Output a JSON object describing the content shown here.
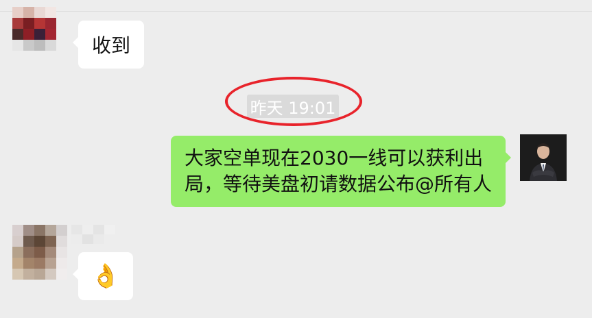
{
  "messages": [
    {
      "sender": "contact",
      "text": "收到"
    },
    {
      "sender": "me",
      "text": "大家空单现在2030一线可以获利出局，等待美盘初请数据公布@所有人"
    },
    {
      "sender": "contact",
      "text": "👌"
    }
  ],
  "timestamp": "昨天 19:01",
  "colors": {
    "background": "#ededed",
    "my_bubble": "#95ec69",
    "their_bubble": "#ffffff",
    "annotation_circle": "#e8232b"
  }
}
